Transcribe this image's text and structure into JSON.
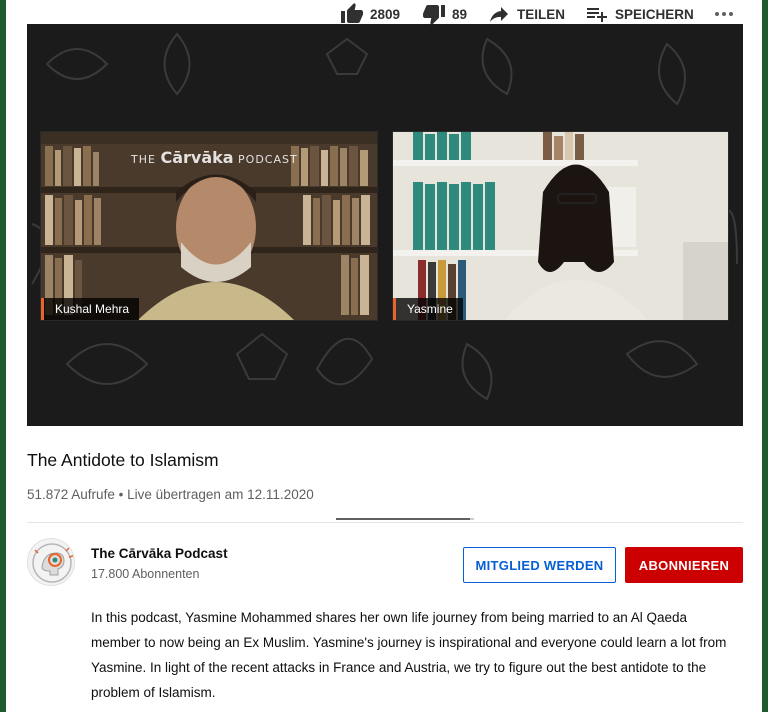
{
  "video": {
    "left_speaker": "Kushal Mehra",
    "right_speaker": "Yasmine",
    "brand_prefix": "THE",
    "brand_name": "Cārvāka",
    "brand_suffix": "PODCAST"
  },
  "title": "The Antidote to Islamism",
  "meta": {
    "views": "51.872 Aufrufe",
    "separator": "•",
    "date": "Live übertragen am 12.11.2020"
  },
  "actions": {
    "likes": "2809",
    "dislikes": "89",
    "share_label": "TEILEN",
    "save_label": "SPEICHERN",
    "like_fraction": 0.97
  },
  "channel": {
    "name": "The Cārvāka Podcast",
    "subscribers": "17.800 Abonnenten",
    "member_button": "MITGLIED WERDEN",
    "subscribe_button": "ABONNIEREN"
  },
  "description": "In this podcast, Yasmine Mohammed shares her own life journey from being married to an Al Qaeda member to now being an Ex Muslim. Yasmine's journey is inspirational and everyone could learn a lot from Yasmine. In light of the recent attacks in France and Austria, we try to figure out the best antidote to the problem of Islamism.",
  "colors": {
    "accent_blue": "#065fd4",
    "subscribe_red": "#cc0000",
    "name_tag_accent": "#e8642c"
  }
}
